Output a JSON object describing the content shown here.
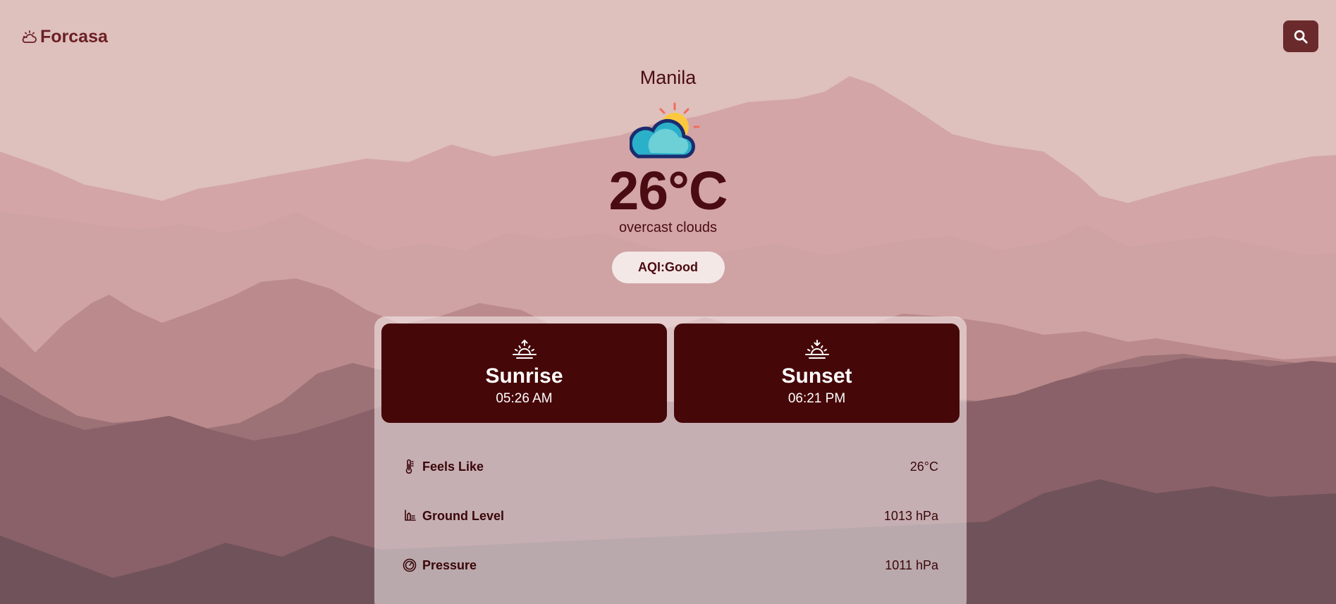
{
  "app": {
    "name": "Forcasa"
  },
  "header": {
    "logo_icon": "cloud-sun-icon",
    "search_icon": "search-icon"
  },
  "current": {
    "city": "Manila",
    "icon": "partly-cloudy-icon",
    "temperature": "26°C",
    "description": "overcast clouds",
    "aqi_label": "AQI:Good"
  },
  "sun": {
    "sunrise": {
      "label": "Sunrise",
      "time": "05:26 AM",
      "icon": "sunrise-icon"
    },
    "sunset": {
      "label": "Sunset",
      "time": "06:21 PM",
      "icon": "sunset-icon"
    }
  },
  "details": [
    {
      "label": "Feels Like",
      "value": "26°C",
      "icon": "thermometer-icon"
    },
    {
      "label": "Ground Level",
      "value": "1013 hPa",
      "icon": "ground-level-icon"
    },
    {
      "label": "Pressure",
      "value": "1011 hPa",
      "icon": "gauge-icon"
    }
  ],
  "colors": {
    "primary": "#4a0c10",
    "card": "#460708",
    "search_button": "#6a2a2c",
    "sky": "#dec0bd"
  }
}
